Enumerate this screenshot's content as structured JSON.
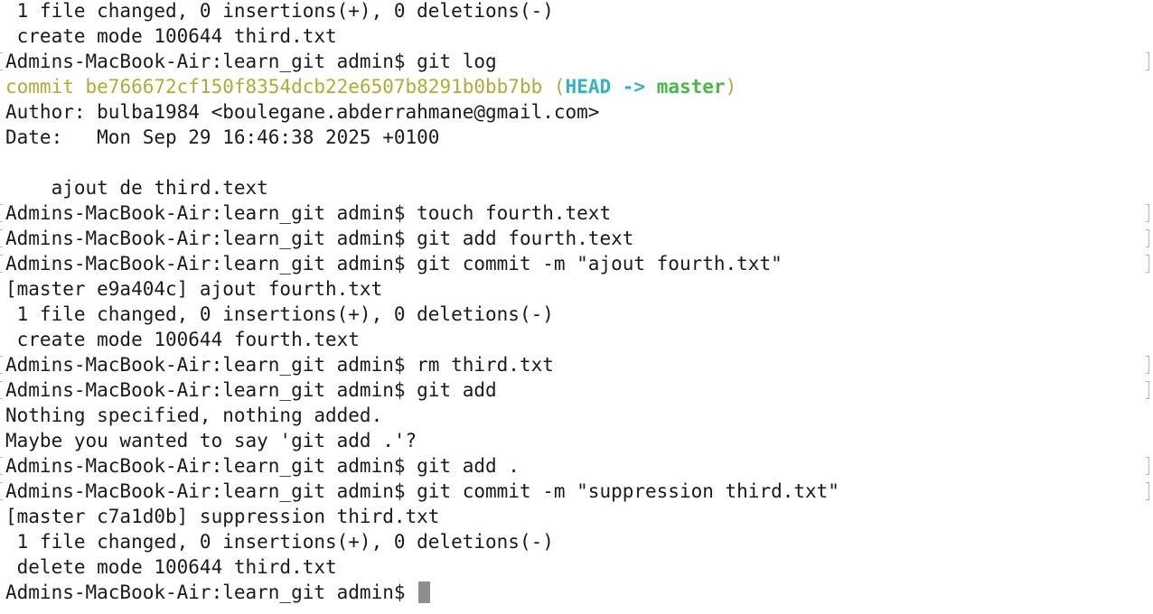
{
  "terminal": {
    "lines": [
      {
        "text": " 1 file changed, 0 insertions(+), 0 deletions(-)"
      },
      {
        "text": " create mode 100644 third.txt"
      },
      {
        "text": "Admins-MacBook-Air:learn_git admin$ git log"
      },
      {
        "commit_prefix": "commit ",
        "hash": "be766672cf150f8354dcb22e6507b8291b0bb7bb",
        "open_paren": " (",
        "head": "HEAD -> ",
        "branch": "master",
        "close_paren": ")"
      },
      {
        "text": "Author: bulba1984 <boulegane.abderrahmane@gmail.com>"
      },
      {
        "text": "Date:   Mon Sep 29 16:46:38 2025 +0100"
      },
      {
        "text": ""
      },
      {
        "text": "    ajout de third.text"
      },
      {
        "text": "Admins-MacBook-Air:learn_git admin$ touch fourth.text"
      },
      {
        "text": "Admins-MacBook-Air:learn_git admin$ git add fourth.text"
      },
      {
        "text": "Admins-MacBook-Air:learn_git admin$ git commit -m \"ajout fourth.txt\""
      },
      {
        "text": "[master e9a404c] ajout fourth.txt"
      },
      {
        "text": " 1 file changed, 0 insertions(+), 0 deletions(-)"
      },
      {
        "text": " create mode 100644 fourth.text"
      },
      {
        "text": "Admins-MacBook-Air:learn_git admin$ rm third.txt"
      },
      {
        "text": "Admins-MacBook-Air:learn_git admin$ git add"
      },
      {
        "text": "Nothing specified, nothing added."
      },
      {
        "text": "Maybe you wanted to say 'git add .'?"
      },
      {
        "text": "Admins-MacBook-Air:learn_git admin$ git add ."
      },
      {
        "text": "Admins-MacBook-Air:learn_git admin$ git commit -m \"suppression third.txt\""
      },
      {
        "text": "[master c7a1d0b] suppression third.txt"
      },
      {
        "text": " 1 file changed, 0 insertions(+), 0 deletions(-)"
      },
      {
        "text": " delete mode 100644 third.txt"
      },
      {
        "text": "Admins-MacBook-Air:learn_git admin$ "
      }
    ],
    "colors": {
      "background": "#ffffff",
      "text": "#1a1a1a",
      "commit_hash": "#b3a93b",
      "head_ref": "#33b3c3",
      "branch_ref": "#46b94a",
      "cursor": "#8e8e8e"
    }
  }
}
